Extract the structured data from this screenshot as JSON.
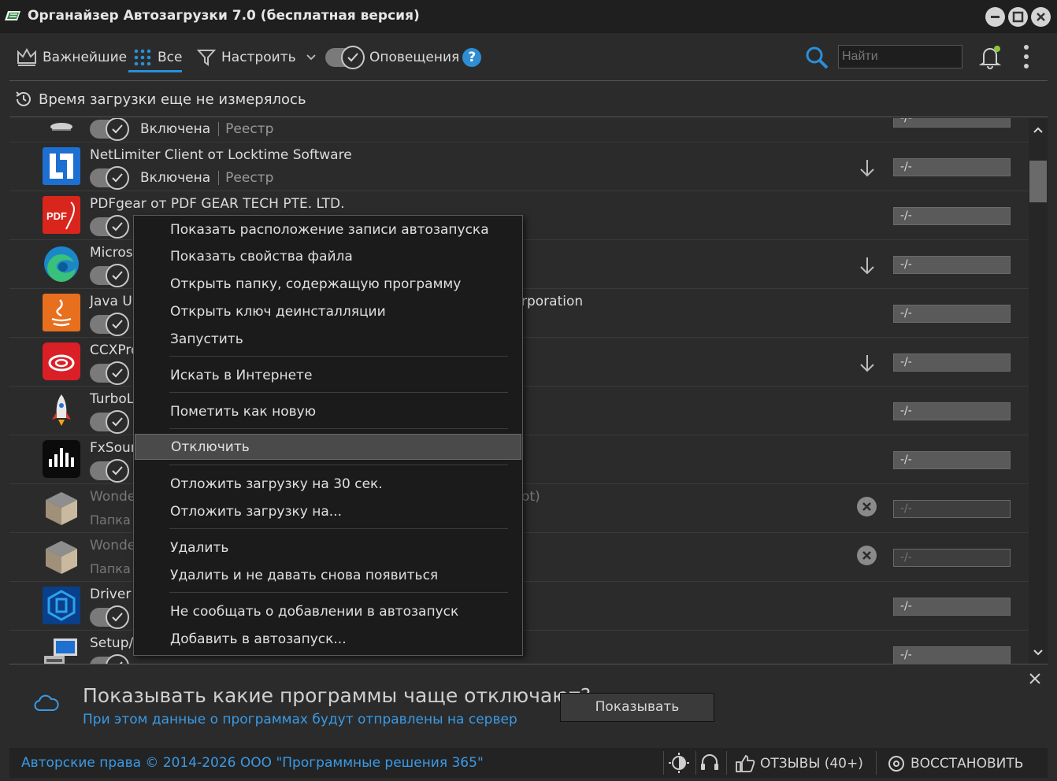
{
  "window": {
    "title": "Органайзер Автозагрузки 7.0 (бесплатная версия)"
  },
  "toolbar": {
    "important_label": "Важнейшие",
    "all_label": "Все",
    "configure_label": "Настроить",
    "notifications_label": "Оповещения",
    "help": "?",
    "search_placeholder": "Найти"
  },
  "status": {
    "boot_time": "Время загрузки еще не измерялось"
  },
  "list": {
    "rows": [
      {
        "name": "",
        "state": "Включена",
        "source": "Реестр",
        "time": "-/-"
      },
      {
        "name": "NetLimiter Client от Locktime Software",
        "state": "Включена",
        "source": "Реестр",
        "time": "-/-"
      },
      {
        "name": "PDFgear от PDF GEAR TECH PTE. LTD.",
        "time": "-/-"
      },
      {
        "name": "Micros",
        "time": "-/-"
      },
      {
        "name": "Java Up",
        "extra": "rporation",
        "time": "-/-"
      },
      {
        "name": "CCXPro",
        "time": "-/-"
      },
      {
        "name": "TurboL",
        "time": "-/-"
      },
      {
        "name": "FxSour",
        "time": "-/-"
      },
      {
        "name": "Wonde",
        "sub": "Папка",
        "extra": "ot)",
        "time": "-/-"
      },
      {
        "name": "Wonde",
        "sub": "Папка",
        "time": "-/-"
      },
      {
        "name": "Driver",
        "time": "-/-"
      },
      {
        "name": "Setup/",
        "time": "-/-"
      }
    ]
  },
  "context_menu": {
    "items": [
      "Показать расположение записи автозапуска",
      "Показать свойства файла",
      "Открыть папку, содержащую программу",
      "Открыть ключ деинсталляции",
      "Запустить",
      "Искать в Интернете",
      "Пометить как новую",
      "Отключить",
      "Отложить загрузку на 30 сек.",
      "Отложить загрузку на...",
      "Удалить",
      "Удалить и не давать снова появиться",
      "Не сообщать о добавлении в автозапуск",
      "Добавить в автозапуск..."
    ]
  },
  "notice": {
    "title": "Показывать какие программы чаще отключают?",
    "subtitle": "При этом данные о программах будут отправлены на сервер",
    "button": "Показывать"
  },
  "footer": {
    "copyright": "Авторские права © 2014-2026 ООО \"Программные решения 365\"",
    "reviews": "ОТЗЫВЫ (40+)",
    "restore": "ВОССТАНОВИТЬ"
  },
  "colors": {
    "accent": "#2a8fd8",
    "link": "#3a9ae6",
    "background": "#2b2b2b"
  }
}
